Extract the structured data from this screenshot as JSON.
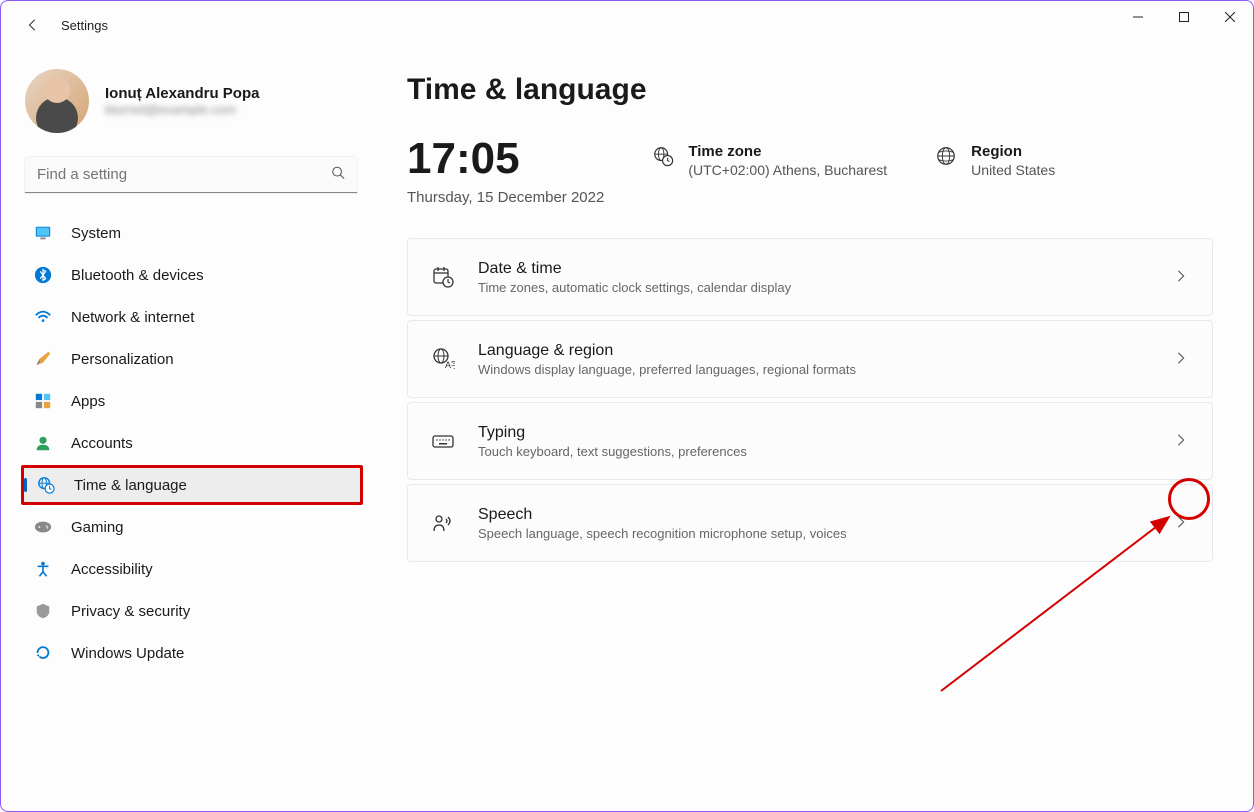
{
  "titlebar": {
    "title": "Settings"
  },
  "profile": {
    "name": "Ionuț Alexandru Popa",
    "email": "blurred@example.com"
  },
  "search": {
    "placeholder": "Find a setting"
  },
  "sidebar": {
    "items": [
      {
        "label": "System"
      },
      {
        "label": "Bluetooth & devices"
      },
      {
        "label": "Network & internet"
      },
      {
        "label": "Personalization"
      },
      {
        "label": "Apps"
      },
      {
        "label": "Accounts"
      },
      {
        "label": "Time & language"
      },
      {
        "label": "Gaming"
      },
      {
        "label": "Accessibility"
      },
      {
        "label": "Privacy & security"
      },
      {
        "label": "Windows Update"
      }
    ]
  },
  "main": {
    "title": "Time & language",
    "clock": {
      "time": "17:05",
      "date": "Thursday, 15 December 2022"
    },
    "timezone": {
      "label": "Time zone",
      "value": "(UTC+02:00) Athens, Bucharest"
    },
    "region": {
      "label": "Region",
      "value": "United States"
    },
    "cards": [
      {
        "title": "Date & time",
        "sub": "Time zones, automatic clock settings, calendar display"
      },
      {
        "title": "Language & region",
        "sub": "Windows display language, preferred languages, regional formats"
      },
      {
        "title": "Typing",
        "sub": "Touch keyboard, text suggestions, preferences"
      },
      {
        "title": "Speech",
        "sub": "Speech language, speech recognition microphone setup, voices"
      }
    ]
  }
}
